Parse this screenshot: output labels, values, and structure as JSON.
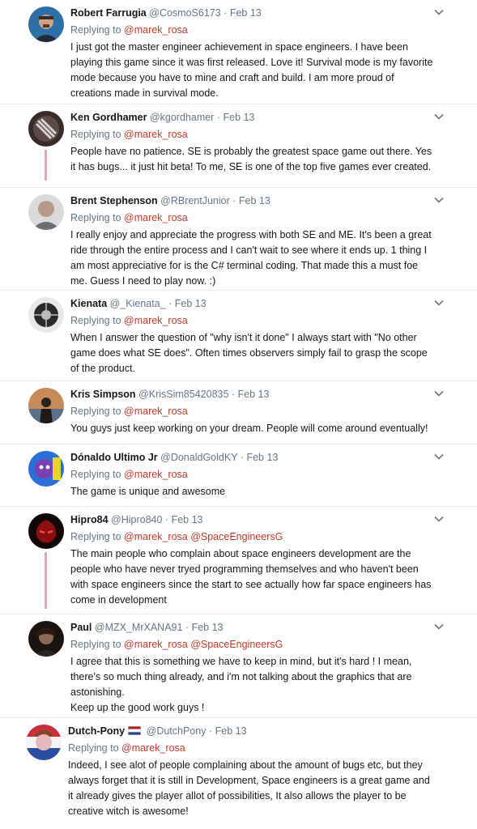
{
  "tweets": [
    {
      "name": "Robert Farrugia",
      "handle": "@CosmoS6173",
      "sep": "·",
      "date": "Feb 13",
      "reply_prefix": "Replying to",
      "mentions": [
        "@marek_rosa"
      ],
      "text": [
        "I just got the master engineer achievement in space engineers. I have been playing this game since it was first released. Love it! Survival mode is my favorite mode because you have to mine and craft and build. I am more proud of creations made in survival mode."
      ]
    },
    {
      "name": "Ken Gordhamer",
      "handle": "@kgordhamer",
      "sep": "·",
      "date": "Feb 13",
      "reply_prefix": "Replying to",
      "mentions": [
        "@marek_rosa"
      ],
      "text": [
        "People have no patience. SE is probably the greatest space game out there. Yes it has bugs... it just hit beta! To me, SE is one of the top five games ever created."
      ]
    },
    {
      "name": "Brent Stephenson",
      "handle": "@RBrentJunior",
      "sep": "·",
      "date": "Feb 13",
      "reply_prefix": "Replying to",
      "mentions": [
        "@marek_rosa"
      ],
      "text": [
        "I really enjoy and appreciate the progress with both SE and ME. It's been a great ride through the entire process and I can't wait to see where it ends up. 1 thing I am most appreciative for is the C# terminal coding. That made this a must foe me. Guess I need to play now. :)"
      ]
    },
    {
      "name": "Kienata",
      "handle": "@_Kienata_",
      "sep": "·",
      "date": "Feb 13",
      "reply_prefix": "Replying to",
      "mentions": [
        "@marek_rosa"
      ],
      "text": [
        "When I answer the question of \"why isn't it done\" I always start with \"No other game does what SE does\". Often times observers simply fail to grasp the scope of the product."
      ]
    },
    {
      "name": "Kris Simpson",
      "handle": "@KrisSim85420835",
      "sep": "·",
      "date": "Feb 13",
      "reply_prefix": "Replying to",
      "mentions": [
        "@marek_rosa"
      ],
      "text": [
        "You guys just keep working on your dream. People will come around eventually!"
      ]
    },
    {
      "name": "Dónaldo Ultimo Jr",
      "handle": "@DonaldGoldKY",
      "sep": "·",
      "date": "Feb 13",
      "reply_prefix": "Replying to",
      "mentions": [
        "@marek_rosa"
      ],
      "text": [
        "The game is unique and awesome"
      ]
    },
    {
      "name": "Hipro84",
      "handle": "@Hipro840",
      "sep": "·",
      "date": "Feb 13",
      "reply_prefix": "Replying to",
      "mentions": [
        "@marek_rosa",
        "@SpaceEngineersG"
      ],
      "text": [
        "The main people who complain about space engineers development are the people who have never tryed programming themselves and who haven't been with space engineers since the start to see actually how far space engineers has come in development"
      ]
    },
    {
      "name": "Paul",
      "handle": "@MZX_MrXANA91",
      "sep": "·",
      "date": "Feb 13",
      "reply_prefix": "Replying to",
      "mentions": [
        "@marek_rosa",
        "@SpaceEngineersG"
      ],
      "text": [
        "I agree that this is something we have to keep in mind, but it's hard ! I mean, there's so much thing already, and i'm not talking about the graphics that are astonishing.",
        "Keep up the good work guys !"
      ]
    },
    {
      "name": "Dutch-Pony",
      "handle": "@DutchPony",
      "sep": "·",
      "date": "Feb 13",
      "reply_prefix": "Replying to",
      "mentions": [
        "@marek_rosa"
      ],
      "text": [
        "Indeed, I see alot of people complaining about the amount of bugs etc, but they always forget that it is still in Development, Space engineers is a great game and it already gives the player allot of possibilities, It also allows the player to be creative witch is awesome!"
      ]
    }
  ],
  "colors": {
    "mention": "#c0392b",
    "thread_line": "#e0a5ad",
    "meta": "#657786",
    "separator": "#e6ecf0"
  },
  "icons": {
    "tweet_menu": "chevron-down-icon",
    "flag": "netherlands-flag-icon"
  }
}
